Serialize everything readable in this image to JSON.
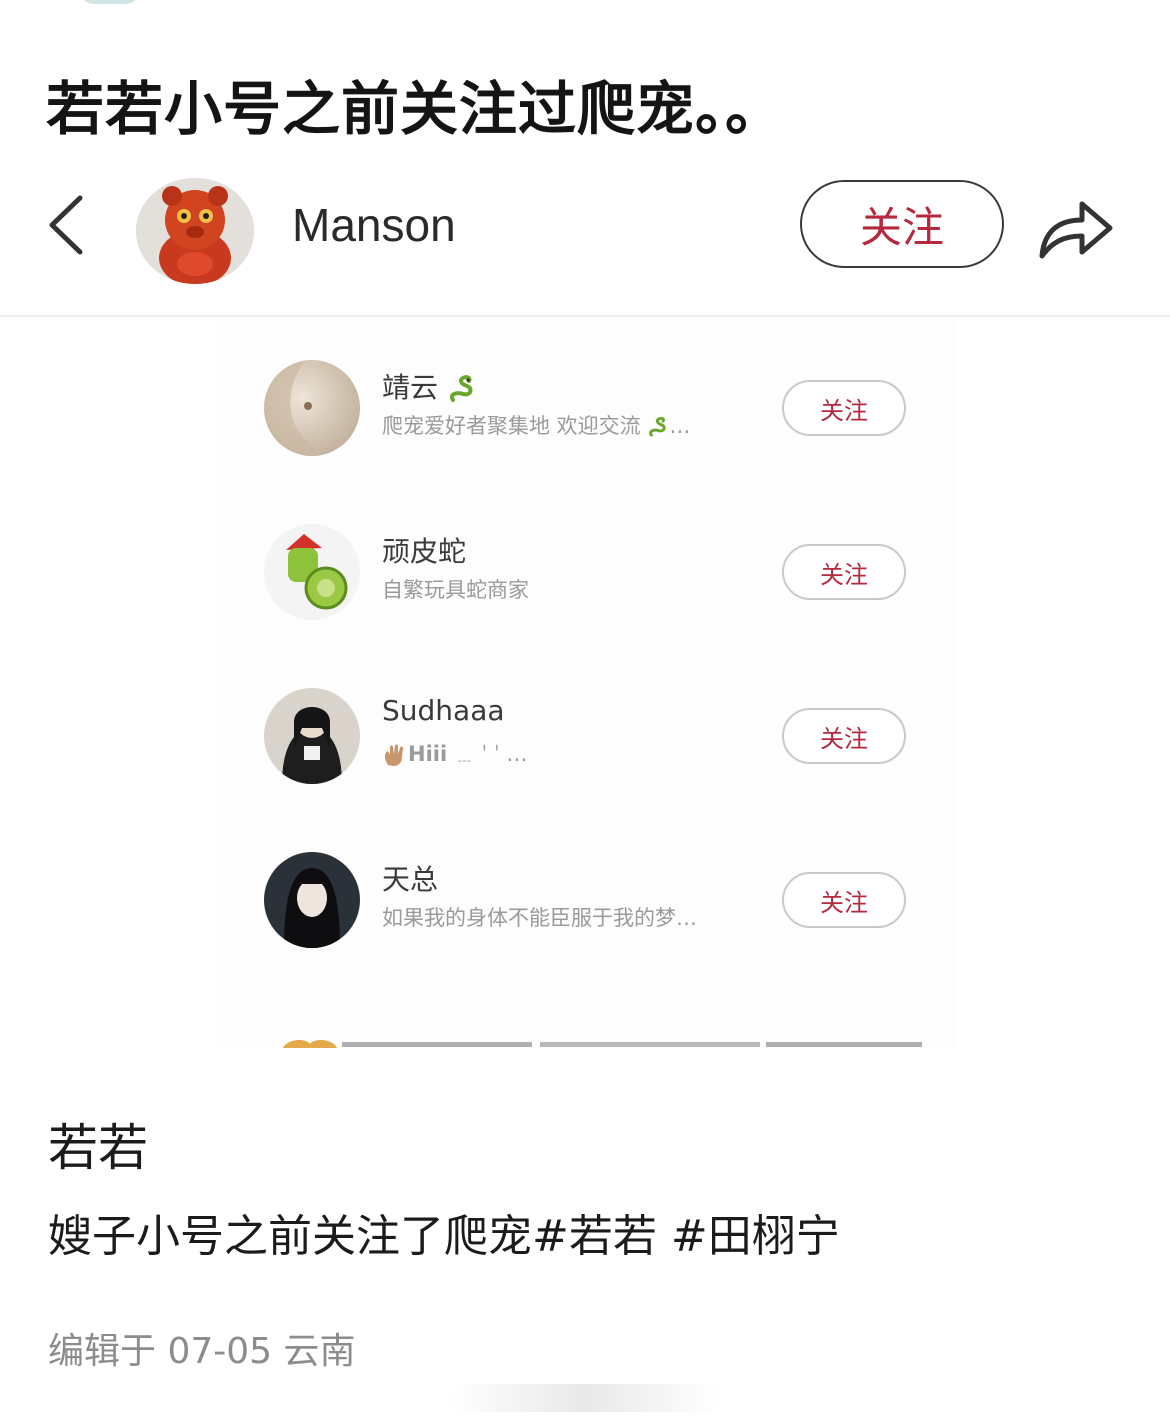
{
  "headline": "若若小号之前关注过爬宠。。",
  "profile": {
    "name": "Manson",
    "follow_label": "关注",
    "back_icon": "chevron-left-icon",
    "share_icon": "share-arrow-icon"
  },
  "follow_list": [
    {
      "name": "靖云",
      "bio": "爬宠爱好者聚集地 欢迎交流",
      "follow_label": "关注"
    },
    {
      "name": "顽皮蛇",
      "bio": "自繁玩具蛇商家",
      "follow_label": "关注"
    },
    {
      "name": "Sudhaaa",
      "bio": "Hiii",
      "follow_label": "关注"
    },
    {
      "name": "天总",
      "bio": "如果我的身体不能臣服于我的梦…",
      "follow_label": "关注"
    }
  ],
  "post": {
    "author": "若若",
    "body": "嫂子小号之前关注了爬宠#若若 #田栩宁",
    "meta": "编辑于 07-05 云南"
  },
  "colors": {
    "accent": "#b5283e",
    "muted_text": "#9a9a9a"
  }
}
